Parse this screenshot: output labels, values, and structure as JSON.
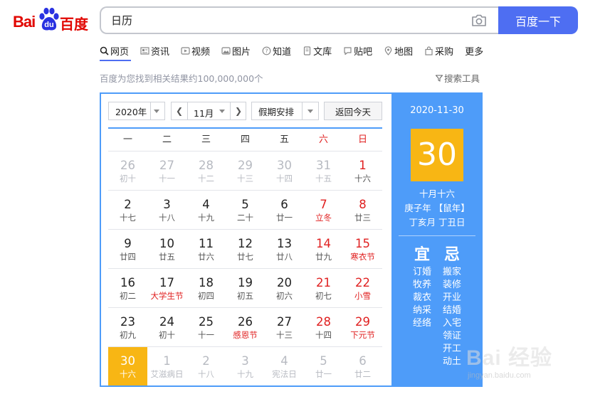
{
  "logo": {
    "bai": "Bai",
    "du": "du",
    "cn": "百度"
  },
  "search": {
    "value": "日历",
    "button_label": "百度一下"
  },
  "tabs": [
    {
      "label": "网页",
      "icon": "search-icon"
    },
    {
      "label": "资讯",
      "icon": "news-icon"
    },
    {
      "label": "视频",
      "icon": "video-icon"
    },
    {
      "label": "图片",
      "icon": "image-icon"
    },
    {
      "label": "知道",
      "icon": "question-icon"
    },
    {
      "label": "文库",
      "icon": "document-icon"
    },
    {
      "label": "贴吧",
      "icon": "forum-icon"
    },
    {
      "label": "地图",
      "icon": "map-pin-icon"
    },
    {
      "label": "采购",
      "icon": "shopping-bag-icon"
    },
    {
      "label": "更多",
      "icon": ""
    }
  ],
  "results": {
    "count_text": "百度为您找到相关结果约100,000,000个",
    "tools_label": "搜索工具"
  },
  "calendar": {
    "year": "2020年",
    "month": "11月",
    "holiday": "假期安排",
    "today_button": "返回今天",
    "weekdays": [
      "一",
      "二",
      "三",
      "四",
      "五",
      "六",
      "日"
    ],
    "weeks": [
      [
        [
          "26",
          "初十",
          "other"
        ],
        [
          "27",
          "十一",
          "other"
        ],
        [
          "28",
          "十二",
          "other"
        ],
        [
          "29",
          "十三",
          "other"
        ],
        [
          "30",
          "十四",
          "other"
        ],
        [
          "31",
          "十五",
          "other"
        ],
        [
          "1",
          "十六",
          "weekend"
        ]
      ],
      [
        [
          "2",
          "十七",
          ""
        ],
        [
          "3",
          "十八",
          ""
        ],
        [
          "4",
          "十九",
          ""
        ],
        [
          "5",
          "二十",
          ""
        ],
        [
          "6",
          "廿一",
          ""
        ],
        [
          "7",
          "立冬",
          "weekend holiday"
        ],
        [
          "8",
          "廿三",
          "weekend"
        ]
      ],
      [
        [
          "9",
          "廿四",
          ""
        ],
        [
          "10",
          "廿五",
          ""
        ],
        [
          "11",
          "廿六",
          ""
        ],
        [
          "12",
          "廿七",
          ""
        ],
        [
          "13",
          "廿八",
          ""
        ],
        [
          "14",
          "廿九",
          "weekend"
        ],
        [
          "15",
          "寒衣节",
          "weekend holiday"
        ]
      ],
      [
        [
          "16",
          "初二",
          ""
        ],
        [
          "17",
          "大学生节",
          "holiday"
        ],
        [
          "18",
          "初四",
          ""
        ],
        [
          "19",
          "初五",
          ""
        ],
        [
          "20",
          "初六",
          ""
        ],
        [
          "21",
          "初七",
          "weekend"
        ],
        [
          "22",
          "小雪",
          "weekend holiday"
        ]
      ],
      [
        [
          "23",
          "初九",
          ""
        ],
        [
          "24",
          "初十",
          ""
        ],
        [
          "25",
          "十一",
          ""
        ],
        [
          "26",
          "感恩节",
          "holiday"
        ],
        [
          "27",
          "十三",
          ""
        ],
        [
          "28",
          "十四",
          "weekend"
        ],
        [
          "29",
          "下元节",
          "weekend holiday"
        ]
      ],
      [
        [
          "30",
          "十六",
          "selected"
        ],
        [
          "1",
          "艾滋病日",
          "other"
        ],
        [
          "2",
          "十八",
          "other"
        ],
        [
          "3",
          "十九",
          "other"
        ],
        [
          "4",
          "宪法日",
          "other"
        ],
        [
          "5",
          "廿一",
          "other"
        ],
        [
          "6",
          "廿二",
          "other"
        ]
      ]
    ],
    "detail": {
      "date": "2020-11-30",
      "day": "30",
      "lunar": "十月十六",
      "ganzhi_year": "庚子年 【鼠年】",
      "ganzhi_month_day": "丁亥月 丁丑日",
      "yi_label": "宜",
      "ji_label": "忌",
      "yi": [
        "订婚",
        "牧养",
        "裁衣",
        "纳采",
        "经络"
      ],
      "ji": [
        "搬家",
        "装修",
        "开业",
        "结婚",
        "入宅",
        "领证",
        "开工",
        "动土"
      ]
    }
  },
  "watermark": {
    "text": "Bai 经验",
    "url": "jingyan.baidu.com"
  },
  "colors": {
    "brand_blue": "#4e6ef2",
    "calendar_blue": "#4e9cf9",
    "selected_yellow": "#f8b614",
    "weekend_red": "#e02020",
    "logo_red": "#e10601"
  }
}
